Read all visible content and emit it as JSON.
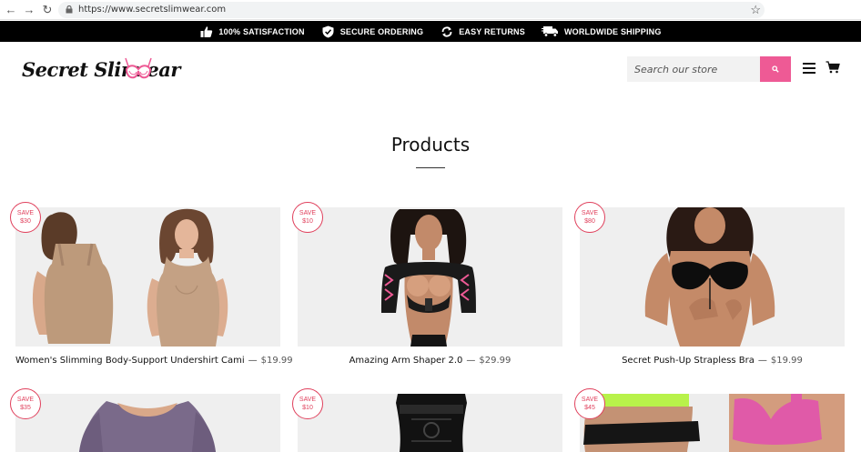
{
  "browser": {
    "url": "https://www.secretslimwear.com",
    "back_glyph": "←",
    "forward_glyph": "→",
    "reload_glyph": "↻",
    "star_glyph": "☆"
  },
  "promo_bar": {
    "items": [
      {
        "icon": "thumbs-up-icon",
        "label": "100% SATISFACTION"
      },
      {
        "icon": "shield-check-icon",
        "label": "SECURE ORDERING"
      },
      {
        "icon": "refresh-icon",
        "label": "EASY RETURNS"
      },
      {
        "icon": "truck-icon",
        "label": "WORLDWIDE SHIPPING"
      }
    ]
  },
  "header": {
    "logo_text": "Secret Slim  ear",
    "search_placeholder": "Search our store"
  },
  "page": {
    "title": "Products"
  },
  "colors": {
    "accent_pink": "#ee5a95",
    "badge_red": "#e0405c",
    "promo_bg": "#000000"
  },
  "products": [
    {
      "save_label": "SAVE",
      "save_amount": "$30",
      "name": "Women's Slimming Body-Support Undershirt Cami",
      "dash": "—",
      "price": "$19.99",
      "image": "tan-cami-photo"
    },
    {
      "save_label": "SAVE",
      "save_amount": "$10",
      "name": "Amazing Arm Shaper 2.0",
      "dash": "—",
      "price": "$29.99",
      "image": "arm-shaper-photo"
    },
    {
      "save_label": "SAVE",
      "save_amount": "$80",
      "name": "Secret Push-Up Strapless Bra",
      "dash": "—",
      "price": "$19.99",
      "image": "strapless-bra-photo"
    },
    {
      "save_label": "SAVE",
      "save_amount": "$35",
      "name": "",
      "dash": "",
      "price": "",
      "image": "purple-top-photo"
    },
    {
      "save_label": "SAVE",
      "save_amount": "$10",
      "name": "",
      "dash": "",
      "price": "",
      "image": "waist-trainer-photo"
    },
    {
      "save_label": "SAVE",
      "save_amount": "$45",
      "name": "",
      "dash": "",
      "price": "",
      "image": "sport-belt-photo"
    }
  ]
}
